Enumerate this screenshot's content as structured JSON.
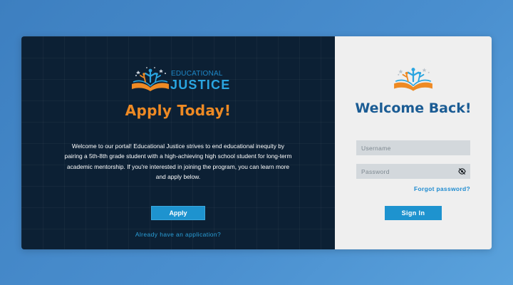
{
  "brand": {
    "logo_line1": "EDUCATIONAL",
    "logo_line2": "JUSTICE",
    "logo_icon": "open-book-stars-icon"
  },
  "apply_panel": {
    "title": "Apply Today!",
    "intro": "Welcome to our portal! Educational Justice strives to end educational inequity by pairing a 5th-8th grade student with a high-achieving high school student for long-term academic mentorship. If you're interested in joining the program, you can learn more and apply below.",
    "apply_button": "Apply",
    "existing_link": "Already have an application?"
  },
  "login_panel": {
    "title": "Welcome Back!",
    "username_placeholder": "Username",
    "password_placeholder": "Password",
    "password_toggle_icon": "eye-off-icon",
    "forgot_link": "Forgot password?",
    "signin_button": "Sign In"
  },
  "colors": {
    "page_background": "#3d7fc0",
    "left_panel": "#0c2034",
    "right_panel": "#efefef",
    "accent_orange": "#ee8a24",
    "accent_blue": "#1e93cf",
    "heading_blue": "#1b5c94",
    "link_blue": "#2a9fd8",
    "input_fill": "#d3d8dc"
  }
}
